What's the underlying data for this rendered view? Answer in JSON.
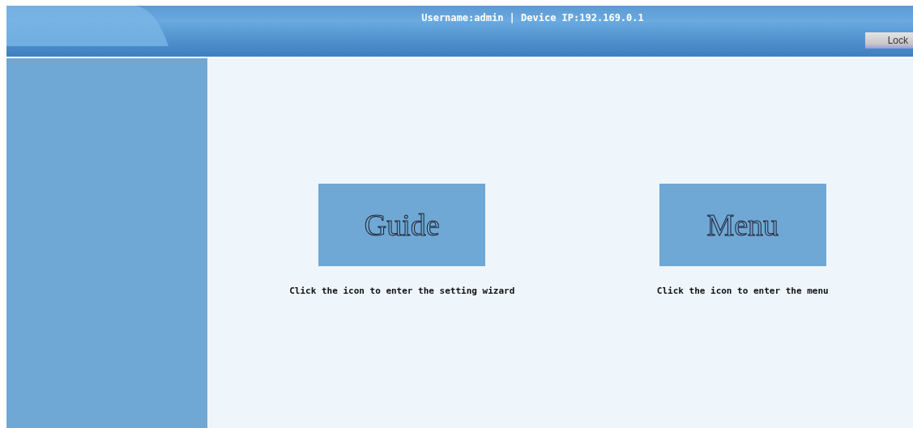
{
  "header": {
    "user_info": "Username:admin | Device IP:192.169.0.1",
    "lock_button": "Lock"
  },
  "shortcuts": [
    {
      "label": "Guide",
      "caption": "Click the icon to enter the setting wizard"
    },
    {
      "label": "Menu",
      "caption": "Click the icon to enter the menu"
    }
  ]
}
